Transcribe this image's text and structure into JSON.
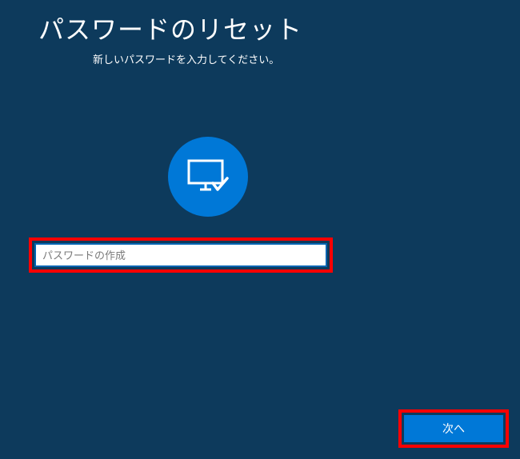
{
  "header": {
    "title": "パスワードのリセット",
    "subtitle": "新しいパスワードを入力してください。"
  },
  "form": {
    "password_placeholder": "パスワードの作成"
  },
  "button": {
    "next_label": "次へ"
  }
}
